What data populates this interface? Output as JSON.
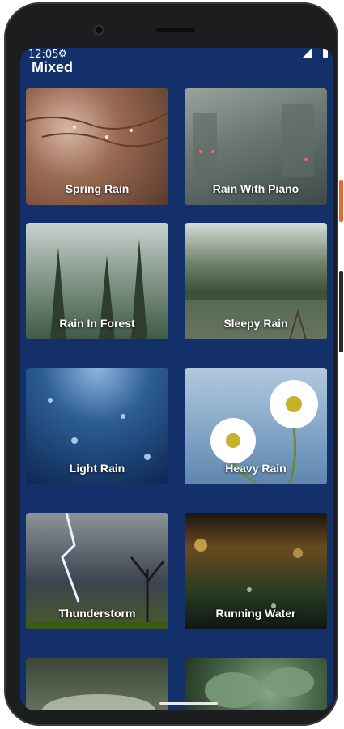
{
  "status_bar": {
    "time": "12:05",
    "settings_icon": "gear-icon",
    "signal_icon": "signal-icon",
    "battery_icon": "battery-icon"
  },
  "header": {
    "title": "Mixed"
  },
  "cards": [
    {
      "label": "Spring Rain"
    },
    {
      "label": "Rain With Piano"
    },
    {
      "label": "Rain In Forest"
    },
    {
      "label": "Sleepy Rain"
    },
    {
      "label": "Light Rain"
    },
    {
      "label": "Heavy Rain"
    },
    {
      "label": "Thunderstorm"
    },
    {
      "label": "Running Water"
    },
    {
      "label": ""
    },
    {
      "label": ""
    }
  ],
  "colors": {
    "screen_background": "#13306a",
    "text": "#ffffff"
  }
}
